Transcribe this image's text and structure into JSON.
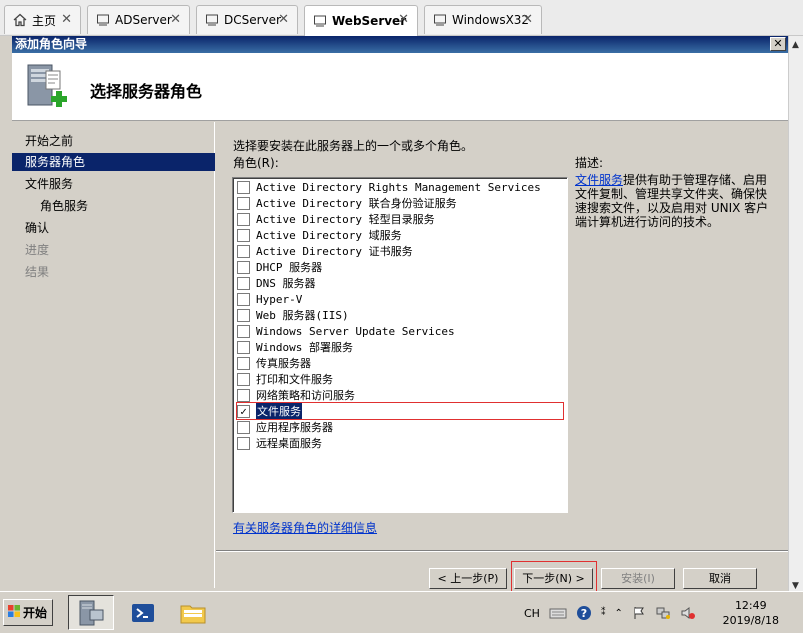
{
  "host_tabs": [
    {
      "label": "主页",
      "icon": "home-icon",
      "active": false
    },
    {
      "label": "ADServer",
      "icon": "vm-icon",
      "active": false
    },
    {
      "label": "DCServer",
      "icon": "vm-icon",
      "active": false
    },
    {
      "label": "WebServer",
      "icon": "vm-icon",
      "active": true
    },
    {
      "label": "WindowsX32",
      "icon": "vm-icon",
      "active": false
    }
  ],
  "dialog": {
    "title": "添加角色向导",
    "header_title": "选择服务器角色"
  },
  "nav": {
    "items": [
      {
        "label": "开始之前",
        "state": "normal"
      },
      {
        "label": "服务器角色",
        "state": "selected"
      },
      {
        "label": "文件服务",
        "state": "normal"
      },
      {
        "label": "角色服务",
        "state": "sub"
      },
      {
        "label": "确认",
        "state": "normal"
      },
      {
        "label": "进度",
        "state": "disabled"
      },
      {
        "label": "结果",
        "state": "disabled"
      }
    ]
  },
  "main": {
    "instruction": "选择要安装在此服务器上的一个或多个角色。",
    "roles_label": "角色(R):",
    "roles": [
      {
        "label": "Active Directory Rights Management Services",
        "checked": false
      },
      {
        "label": "Active Directory 联合身份验证服务",
        "checked": false
      },
      {
        "label": "Active Directory 轻型目录服务",
        "checked": false
      },
      {
        "label": "Active Directory 域服务",
        "checked": false
      },
      {
        "label": "Active Directory 证书服务",
        "checked": false
      },
      {
        "label": "DHCP 服务器",
        "checked": false
      },
      {
        "label": "DNS 服务器",
        "checked": false
      },
      {
        "label": "Hyper-V",
        "checked": false
      },
      {
        "label": "Web 服务器(IIS)",
        "checked": false
      },
      {
        "label": "Windows Server Update Services",
        "checked": false
      },
      {
        "label": "Windows 部署服务",
        "checked": false
      },
      {
        "label": "传真服务器",
        "checked": false
      },
      {
        "label": "打印和文件服务",
        "checked": false
      },
      {
        "label": "网络策略和访问服务",
        "checked": false
      },
      {
        "label": "文件服务",
        "checked": true
      },
      {
        "label": "应用程序服务器",
        "checked": false
      },
      {
        "label": "远程桌面服务",
        "checked": false
      }
    ],
    "description_title": "描述:",
    "description_link": "文件服务",
    "description_text": "提供有助于管理存储、启用文件复制、管理共享文件夹、确保快速搜索文件，以及启用对 UNIX 客户端计算机进行访问的技术。",
    "more_info_link": "有关服务器角色的详细信息"
  },
  "buttons": {
    "prev": "< 上一步(P)",
    "next": "下一步(N) >",
    "install": "安装(I)",
    "cancel": "取消"
  },
  "taskbar": {
    "start_label": "开始",
    "lang": "CH",
    "time": "12:49",
    "date": "2019/8/18"
  },
  "colors": {
    "title_bar": "#0a246a",
    "selection": "#0a246a",
    "highlight_outline": "#e03030",
    "link": "#0033cc"
  }
}
